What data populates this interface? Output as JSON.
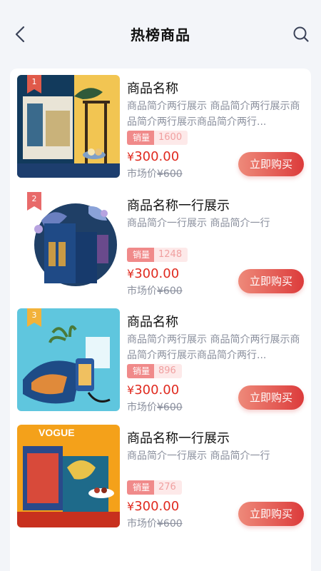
{
  "header": {
    "title": "热榜商品",
    "back_icon": "chevron-left-icon",
    "search_icon": "search-icon"
  },
  "products": [
    {
      "rank": "1",
      "name": "商品名称",
      "desc": "商品简介两行展示 商品简介两行展示商品简介两行展示商品简介两行...",
      "sales_label": "销量",
      "sales": "1600",
      "price_symbol": "¥",
      "price": "300.00",
      "market_label": "市场价",
      "market_price": "¥600",
      "buy_label": "立即购买",
      "rank_color": "#e05a4a"
    },
    {
      "rank": "2",
      "name": "商品名称一行展示",
      "desc": "商品简介一行展示 商品简介一行",
      "sales_label": "销量",
      "sales": "1248",
      "price_symbol": "¥",
      "price": "300.00",
      "market_label": "市场价",
      "market_price": "¥600",
      "buy_label": "立即购买",
      "rank_color": "#e86a6a"
    },
    {
      "rank": "3",
      "name": "商品名称",
      "desc": "商品简介两行展示 商品简介两行展示商品简介两行展示商品简介两行...",
      "sales_label": "销量",
      "sales": "896",
      "price_symbol": "¥",
      "price": "300.00",
      "market_label": "市场价",
      "market_price": "¥600",
      "buy_label": "立即购买",
      "rank_color": "#f2b23a"
    },
    {
      "rank": "",
      "name": "商品名称一行展示",
      "desc": "商品简介一行展示 商品简介一行",
      "sales_label": "销量",
      "sales": "276",
      "price_symbol": "¥",
      "price": "300.00",
      "market_label": "市场价",
      "market_price": "¥600",
      "buy_label": "立即购买",
      "rank_color": ""
    }
  ],
  "colors": {
    "accent_red": "#e02b20",
    "button_gradient_start": "#ee8a7a",
    "button_gradient_end": "#dc3b3b",
    "muted_text": "#8a8f9d",
    "background": "#f3f5f9"
  }
}
